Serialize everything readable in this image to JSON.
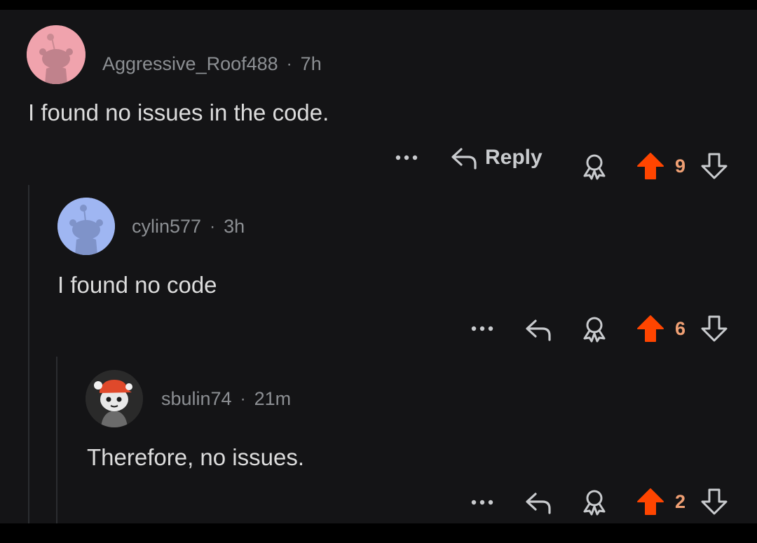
{
  "comments": [
    {
      "username": "Aggressive_Roof488",
      "age": "7h",
      "text": "I found no issues in the code.",
      "reply_label": "Reply",
      "score": "9",
      "avatar_bg": "#f0a3ad"
    },
    {
      "username": "cylin577",
      "age": "3h",
      "text": "I found no code",
      "reply_label": "",
      "score": "6",
      "avatar_bg": "#9fb6f2"
    },
    {
      "username": "sbulin74",
      "age": "21m",
      "text": "Therefore, no issues.",
      "reply_label": "",
      "score": "2",
      "avatar_bg": "#2a2a2a"
    }
  ],
  "separator": "·",
  "icons": {
    "more": "more-options-icon",
    "reply": "reply-arrow-icon",
    "award": "award-icon",
    "upvote": "upvote-arrow-icon",
    "downvote": "downvote-arrow-icon"
  },
  "colors": {
    "background": "#141416",
    "upvote": "#ff4500",
    "score": "#f0a074",
    "text": "#dcdcdc",
    "meta": "#8c8f93"
  }
}
